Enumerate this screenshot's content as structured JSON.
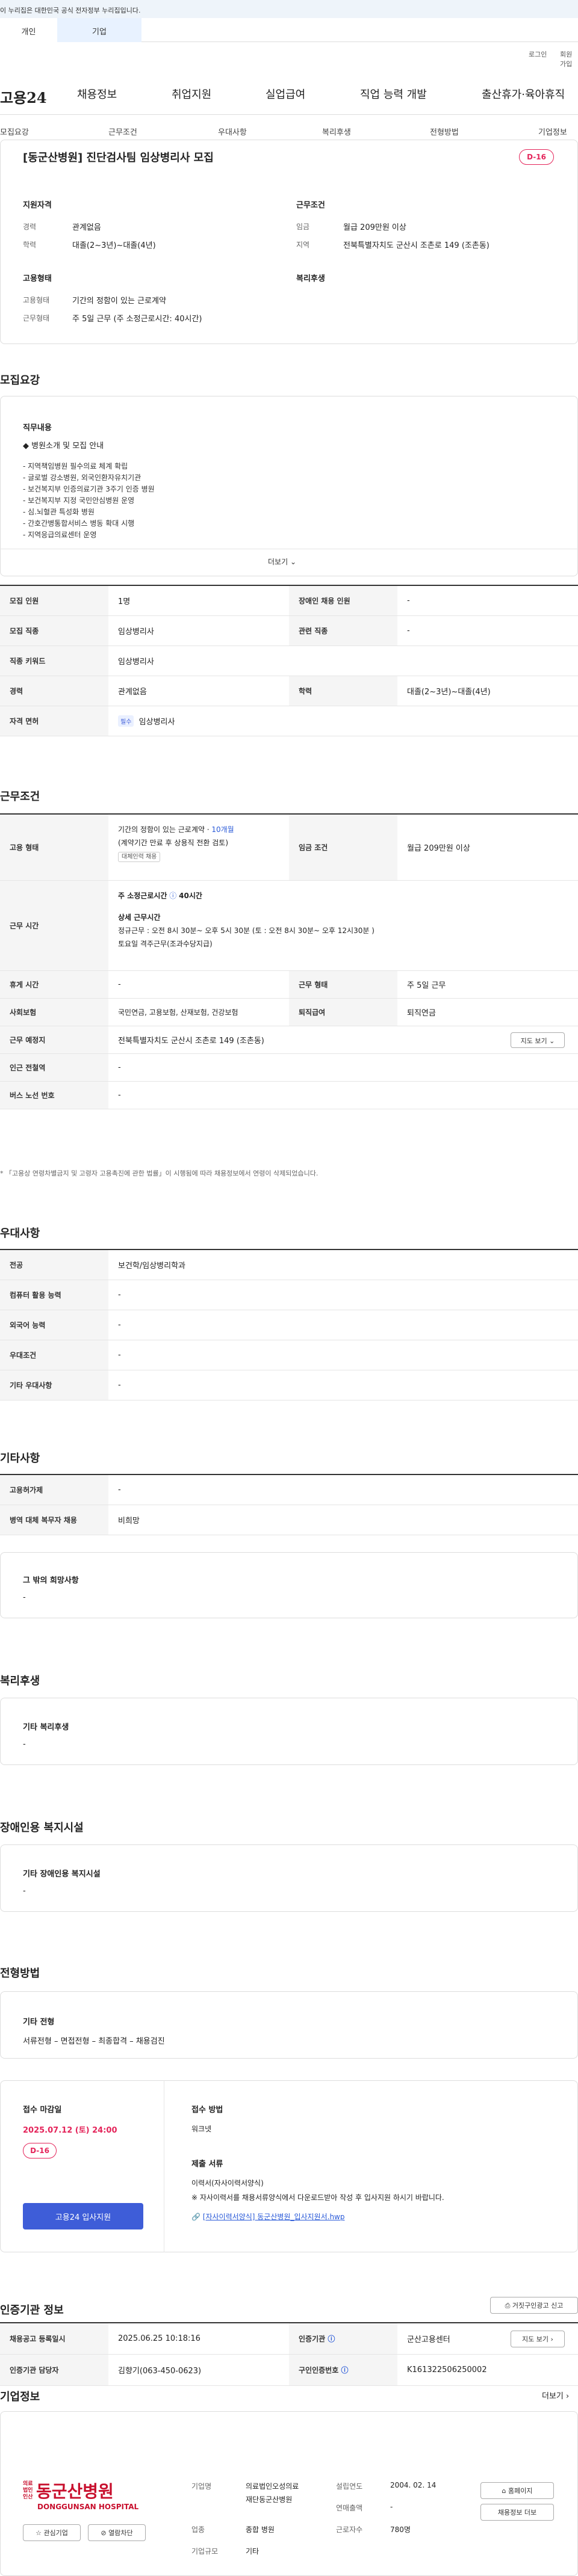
{
  "topbar": {
    "notice": "이 누리집은 대한민국 공식 전자정부 누리집입니다."
  },
  "usertabs": {
    "person": "개인",
    "corp": "기업"
  },
  "util": {
    "login": "로그인",
    "join": "회원가입"
  },
  "logo": "고용24",
  "gnb": [
    "채용정보",
    "취업지원",
    "실업급여",
    "직업 능력 개발",
    "출산휴가·육아휴직"
  ],
  "snb": [
    "모집요강",
    "근무조건",
    "우대사항",
    "복리후생",
    "전형방법",
    "기업정보"
  ],
  "summary": {
    "title": "[동군산병원] 진단검사팀 임상병리사 모집",
    "dday": "D-16",
    "applicant_h": "지원자격",
    "career_l": "경력",
    "career_v": "관계없음",
    "edu_l": "학력",
    "edu_v": "대졸(2~3년)~대졸(4년)",
    "cond_h": "근무조건",
    "wage_l": "임금",
    "wage_v": "월급 209만원 이상",
    "region_l": "지역",
    "region_v": "전북특별자치도 군산시 조촌로 149 (조촌동)",
    "emp_h": "고용형태",
    "emptype_l": "고용형태",
    "emptype_v": "기간의 정함이 있는 근로계약",
    "worktype_l": "근무형태",
    "worktype_v": "주 5일 근무 (주 소정근로시간: 40시간)",
    "welfare_h": "복리후생"
  },
  "recruit": {
    "title": "모집요강",
    "duty_h": "직무내용",
    "intro": "◆ 병원소개 및 모집 안내",
    "lines": [
      "- 지역책임병원 필수의료 체계 확립",
      "- 글로벌 강소병원, 외국인환자유치기관",
      "- 보건복지부 인증의료기관 3주기 인증 병원",
      "- 보건복지부 지정 국민안심병원 운영",
      "- 심.뇌혈관 특성화 병원",
      "- 간호간병통합서비스 병동 확대 시행",
      "- 지역응급의료센터 운영"
    ],
    "more": "더보기",
    "rows": [
      {
        "l1": "모집 인원",
        "v1": "1명",
        "l2": "장애인 채용 인원",
        "v2": "-"
      },
      {
        "l1": "모집 직종",
        "v1": "임상병리사",
        "l2": "관련 직종",
        "v2": "-"
      },
      {
        "l1": "직종 키워드",
        "v1": "임상병리사"
      },
      {
        "l1": "경력",
        "v1": "관계없음",
        "l2": "학력",
        "v2": "대졸(2~3년)~대졸(4년)"
      },
      {
        "l1": "자격 면허",
        "tag": "필수",
        "v1": "임상병리사"
      }
    ]
  },
  "work": {
    "title": "근무조건",
    "emp_l": "고용 형태",
    "emp_v1": "기간의 정함이 있는 근로계약 · ",
    "emp_v1b": "10개월",
    "emp_v2": "(계약기간 만료 후 상용직 전환 검토)",
    "emp_tag": "대체인력 채용",
    "wage_l": "임금 조건",
    "wage_v": "월급 209만원 이상",
    "time_l": "근무 시간",
    "time_v1": "주 소정근로시간",
    "time_v1b": "40시간",
    "time_v2": "상세 근무시간",
    "time_v3": "정규근무 : 오전 8시 30분~ 오후 5시 30분 (토 : 오전 8시 30분~ 오후 12시30분 )",
    "time_v4": "토요일 격주근무(조과수당지급)",
    "rest_l": "휴게 시간",
    "rest_v": "-",
    "form_l": "근무 형태",
    "form_v": "주 5일 근무",
    "ins_l": "사회보험",
    "ins_v": "국민연금, 고용보험, 산재보험, 건강보험",
    "ret_l": "퇴직급여",
    "ret_v": "퇴직연금",
    "place_l": "근무 예정지",
    "place_v": "전북특별자치도 군산시 조촌로 149 (조촌동)",
    "map_btn": "지도 보기",
    "sub_l": "인근 전철역",
    "sub_v": "-",
    "bus_l": "버스 노선 번호",
    "bus_v": "-",
    "note": "* 「고용상 연령차별금지 및 고령자 고용촉진에 관한 법률」이 시행됨에 따라 채용정보에서 연령이 삭제되었습니다."
  },
  "pref": {
    "title": "우대사항",
    "rows": [
      {
        "l": "전공",
        "v": "보건학/임상병리학과"
      },
      {
        "l": "컴퓨터 활용 능력",
        "v": "-"
      },
      {
        "l": "외국어 능력",
        "v": "-"
      },
      {
        "l": "우대조건",
        "v": "-"
      },
      {
        "l": "기타 우대사항",
        "v": "-"
      }
    ]
  },
  "etc": {
    "title": "기타사항",
    "rows": [
      {
        "l": "고용허가제",
        "v": "-"
      },
      {
        "l": "병역 대체 복무자 채용",
        "v": "비희망"
      }
    ],
    "hope_h": "그 밖의 희망사항",
    "hope_v": "-"
  },
  "welfare": {
    "title": "복리후생",
    "h": "기타 복리후생",
    "v": "-"
  },
  "disability": {
    "title": "장애인용 복지시설",
    "h": "기타 장애인용 복지시설",
    "v": "-"
  },
  "process": {
    "title": "전형방법",
    "h": "기타 전형",
    "v": "서류전형 – 면접전형 – 최종합격 – 채용검진",
    "deadline_h": "접수 마감일",
    "deadline_v": "2025.07.12 (토) 24:00",
    "dday": "D-16",
    "apply_btn": "고용24 입사지원",
    "method_h": "접수 방법",
    "method_v": "워크넷",
    "docs_h": "제출 서류",
    "docs_v1": "이력서(자사이력서양식)",
    "docs_v2": "※ 자사이력서를 채용서류양식에서 다운로드받아 작성 후 입사지원 하시기 바랍니다.",
    "docs_file": "[자사이력서양식] 동군산병원_입사지원서.hwp"
  },
  "agency": {
    "title": "인증기관 정보",
    "report_btn": "거짓구인광고 신고",
    "r1l1": "채용공고 등록일시",
    "r1v1": "2025.06.25 10:18:16",
    "r1l2": "인증기관",
    "r1v2": "군산고용센터",
    "map_btn": "지도 보기",
    "r2l1": "인증기관 담당자",
    "r2v1": "김향기(063-450-0623)",
    "r2l2": "구인인증번호",
    "r2v2": "K161322506250002"
  },
  "company": {
    "title": "기업정보",
    "more": "더보기",
    "logo_main": "동군산병원",
    "logo_pre": "의료법인 인산",
    "logo_en": "DONGGUNSAN HOSPITAL",
    "interest_btn": "관심기업",
    "block_btn": "열람차단",
    "name_l": "기업명",
    "name_v1": "의료법인오성의료",
    "name_v2": "재단동군산병원",
    "est_l": "설립연도",
    "est_v": "2004. 02. 14",
    "sales_l": "연매출액",
    "sales_v": "-",
    "ind_l": "업종",
    "ind_v": "종합 병원",
    "emp_l": "근로자수",
    "emp_v": "780명",
    "size_l": "기업규모",
    "size_v": "기타",
    "home_btn": "홈페이지",
    "jobs_btn": "채용정보 더보"
  },
  "colors": {
    "accent": "#3e5dd8",
    "dday": "#e4245a"
  }
}
